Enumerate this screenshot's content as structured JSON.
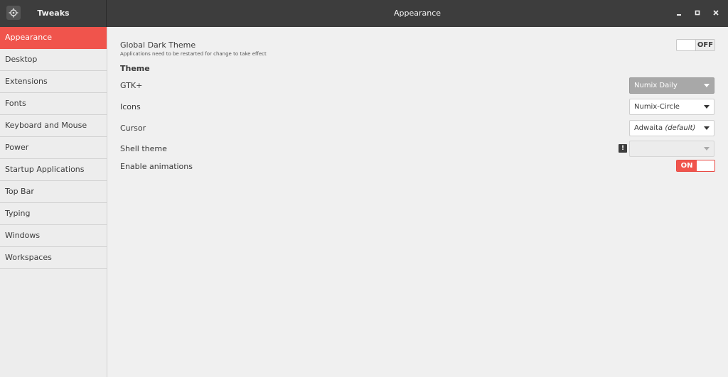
{
  "app": {
    "title": "Tweaks"
  },
  "window": {
    "title": "Appearance"
  },
  "sidebar": {
    "items": [
      {
        "label": "Appearance",
        "active": true
      },
      {
        "label": "Desktop"
      },
      {
        "label": "Extensions"
      },
      {
        "label": "Fonts"
      },
      {
        "label": "Keyboard and Mouse"
      },
      {
        "label": "Power"
      },
      {
        "label": "Startup Applications"
      },
      {
        "label": "Top Bar"
      },
      {
        "label": "Typing"
      },
      {
        "label": "Windows"
      },
      {
        "label": "Workspaces"
      }
    ]
  },
  "appearance": {
    "global_dark": {
      "label": "Global Dark Theme",
      "subtext": "Applications need to be restarted for change to take effect",
      "state": "OFF"
    },
    "section_theme": "Theme",
    "gtk": {
      "label": "GTK+",
      "value": "Numix Daily"
    },
    "icons": {
      "label": "Icons",
      "value": "Numix-Circle"
    },
    "cursor": {
      "label": "Cursor",
      "value": "Adwaita",
      "value_suffix": "(default)"
    },
    "shell": {
      "label": "Shell theme",
      "value": "",
      "warning": "!"
    },
    "animations": {
      "label": "Enable animations",
      "state": "ON"
    }
  },
  "colors": {
    "accent": "#f0544c",
    "titlebar": "#3d3d3d",
    "background": "#ededed"
  },
  "icons": {
    "app": "crosshair-icon",
    "minimize": "minimize-icon",
    "maximize": "maximize-icon",
    "close": "close-icon",
    "dropdown": "chevron-down-icon",
    "warning": "warning-icon"
  }
}
